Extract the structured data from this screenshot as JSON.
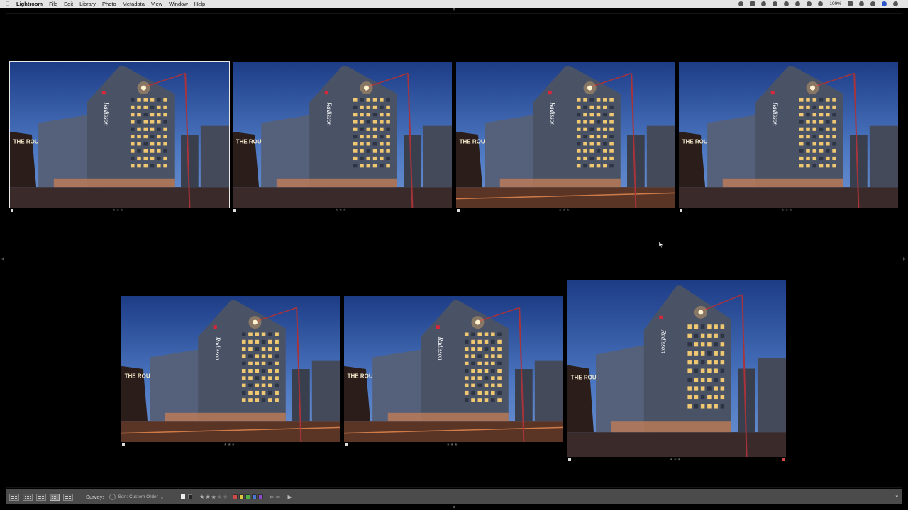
{
  "menubar": {
    "app_name": "Lightroom",
    "items": [
      "File",
      "Edit",
      "Library",
      "Photo",
      "Metadata",
      "View",
      "Window",
      "Help"
    ],
    "battery": "100%"
  },
  "toolbar": {
    "mode_label": "Survey:",
    "sort_label": "Sort: Custom Order",
    "stars": "★★★★★",
    "rating_filled": 3,
    "rating_total": 5,
    "color_labels": [
      "#d24a4a",
      "#d9c640",
      "#52b04a",
      "#4a77d1",
      "#8a4ac9"
    ]
  },
  "photos": [
    {
      "id": "p1",
      "selected": true,
      "rating": 3
    },
    {
      "id": "p2",
      "selected": false,
      "rating": 3
    },
    {
      "id": "p3",
      "selected": false,
      "rating": 3
    },
    {
      "id": "p4",
      "selected": false,
      "rating": 3
    },
    {
      "id": "p5",
      "selected": false,
      "rating": 3
    },
    {
      "id": "p6",
      "selected": false,
      "rating": 3
    },
    {
      "id": "p7",
      "selected": false,
      "rating": 3
    }
  ],
  "building_sign": "Radisson",
  "venue_sign": "THE ROUND"
}
